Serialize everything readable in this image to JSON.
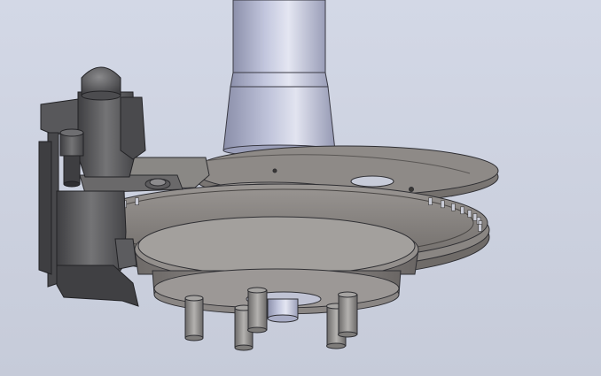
{
  "viewport": {
    "background_top": "#d3d8e6",
    "background_bottom": "#c6cbd9"
  },
  "model": {
    "strut_tube_color": "#bcc0d8",
    "rotor_color": "#7f7b78",
    "caliper_color": "#5e5e60",
    "stud_color": "#8e8c8a",
    "edge_color": "#2f2f33"
  }
}
